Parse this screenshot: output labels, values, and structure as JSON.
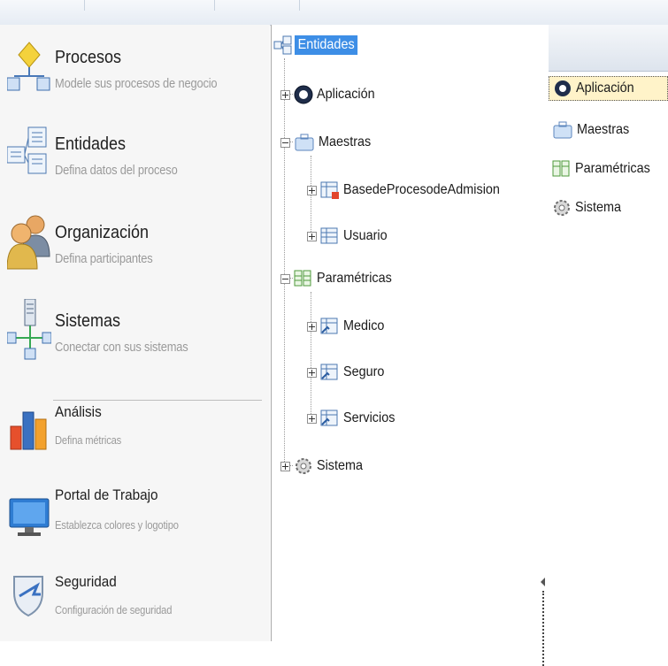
{
  "nav": {
    "items": [
      {
        "title": "Procesos",
        "subtitle": "Modele sus procesos de negocio",
        "icon": "process-diagram-icon"
      },
      {
        "title": "Entidades",
        "subtitle": "Defina datos del proceso",
        "icon": "entities-icon"
      },
      {
        "title": "Organización",
        "subtitle": "Defina participantes",
        "icon": "users-icon"
      },
      {
        "title": "Sistemas",
        "subtitle": "Conectar con sus sistemas",
        "icon": "network-icon"
      },
      {
        "title": "Análisis",
        "subtitle": "Defina métricas",
        "icon": "bar-chart-icon"
      },
      {
        "title": "Portal de Trabajo",
        "subtitle": "Establezca colores y logotipo",
        "icon": "monitor-icon"
      },
      {
        "title": "Seguridad",
        "subtitle": "Configuración  de seguridad",
        "icon": "shield-icon"
      }
    ]
  },
  "tree": {
    "root": {
      "label": "Entidades",
      "icon": "entities-icon",
      "selected": true
    },
    "nodes": [
      {
        "label": "Aplicación",
        "icon": "app-badge-icon",
        "expander": "plus"
      },
      {
        "label": "Maestras",
        "icon": "briefcase-icon",
        "expander": "minus"
      },
      {
        "label": "BasedeProcesodeAdmision",
        "icon": "table-key-icon",
        "expander": "plus"
      },
      {
        "label": "Usuario",
        "icon": "table-icon",
        "expander": "plus"
      },
      {
        "label": "Paramétricas",
        "icon": "param-table-icon",
        "expander": "minus"
      },
      {
        "label": "Medico",
        "icon": "table-form-icon",
        "expander": "plus"
      },
      {
        "label": "Seguro",
        "icon": "table-form-icon",
        "expander": "plus"
      },
      {
        "label": "Servicios",
        "icon": "table-form-icon",
        "expander": "plus"
      },
      {
        "label": "Sistema",
        "icon": "gear-icon",
        "expander": "plus"
      }
    ]
  },
  "list": {
    "items": [
      {
        "label": "Aplicación",
        "icon": "app-badge-icon",
        "selected": true
      },
      {
        "label": "Maestras",
        "icon": "briefcase-icon"
      },
      {
        "label": "Paramétricas",
        "icon": "param-table-icon"
      },
      {
        "label": "Sistema",
        "icon": "gear-icon"
      }
    ]
  },
  "colors": {
    "selection": "#3d8ee6",
    "list_selection": "#fff3c9",
    "muted_text": "#9a9a9a"
  }
}
